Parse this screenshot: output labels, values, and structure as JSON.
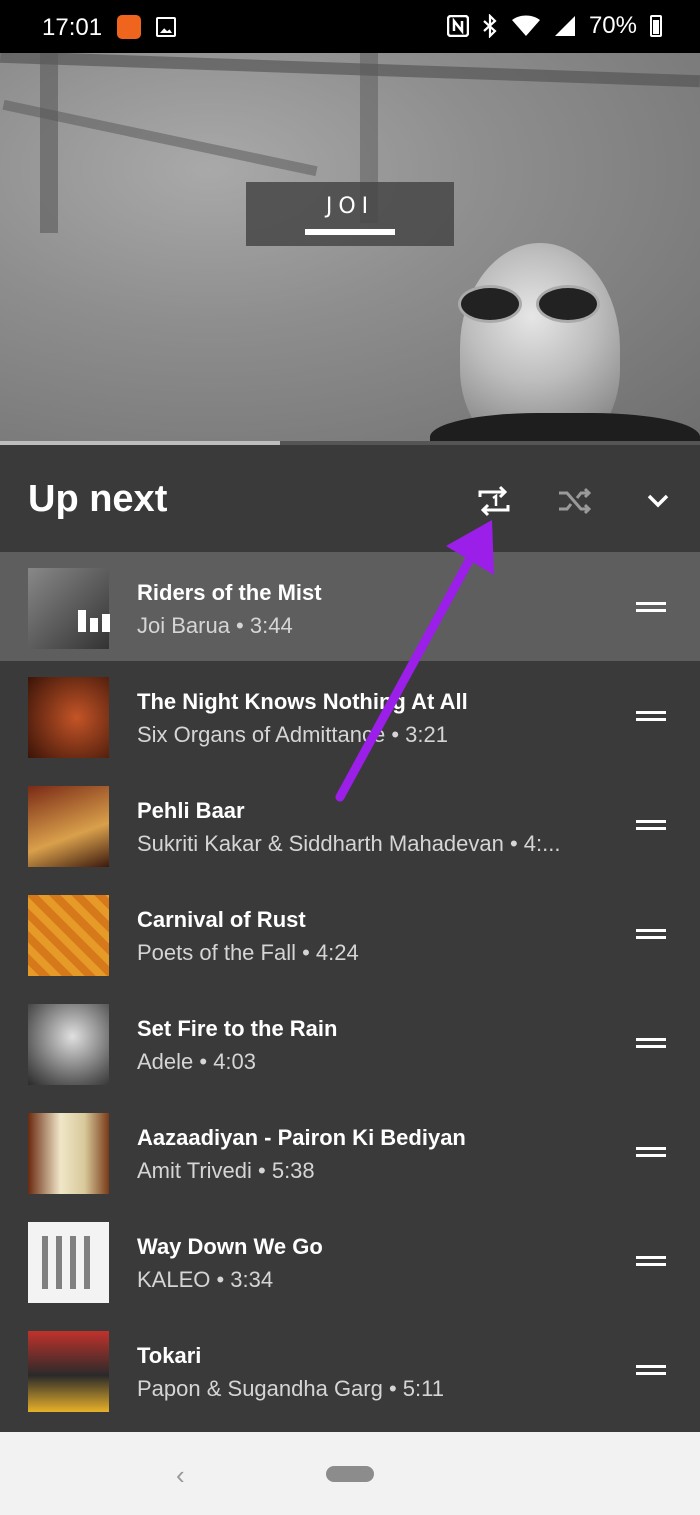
{
  "status_bar": {
    "time": "17:01",
    "battery_percent": "70%",
    "icons": [
      "app-notification-icon",
      "image-icon",
      "nfc-icon",
      "bluetooth-icon",
      "wifi-icon",
      "signal-icon",
      "battery-icon"
    ]
  },
  "now_playing": {
    "album_title": "JOI",
    "progress_fraction": 0.4
  },
  "queue": {
    "header": "Up next",
    "controls": [
      "repeat-one-icon",
      "shuffle-icon",
      "chevron-down-icon"
    ],
    "items": [
      {
        "title": "Riders of the Mist",
        "subtitle": "Joi Barua • 3:44",
        "playing": true
      },
      {
        "title": "The Night Knows Nothing At All",
        "subtitle": "Six Organs of Admittance • 3:21"
      },
      {
        "title": "Pehli Baar",
        "subtitle": "Sukriti Kakar & Siddharth Mahadevan • 4:..."
      },
      {
        "title": "Carnival of Rust",
        "subtitle": "Poets of the Fall • 4:24"
      },
      {
        "title": "Set Fire to the Rain",
        "subtitle": "Adele • 4:03"
      },
      {
        "title": "Aazaadiyan - Pairon Ki Bediyan",
        "subtitle": "Amit Trivedi • 5:38"
      },
      {
        "title": "Way Down We Go",
        "subtitle": "KALEO • 3:34"
      },
      {
        "title": "Tokari",
        "subtitle": "Papon & Sugandha Garg • 5:11"
      }
    ]
  },
  "nav_bar": {
    "back_glyph": "‹"
  },
  "colors": {
    "annotation_arrow": "#9b1fe8",
    "panel_background": "#3a3a3a",
    "active_row": "#5e5e5e"
  }
}
